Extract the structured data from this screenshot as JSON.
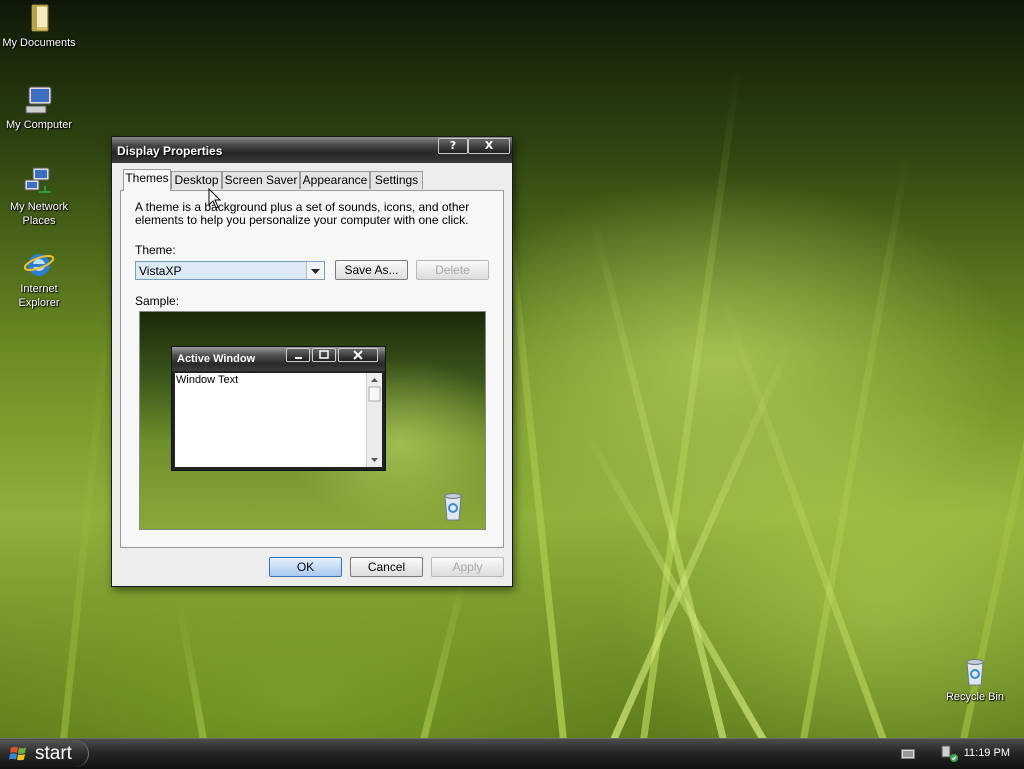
{
  "desktop": {
    "icons": [
      {
        "label": "My Documents",
        "icon": "folder-documents-icon"
      },
      {
        "label": "My Computer",
        "icon": "computer-icon"
      },
      {
        "label": "My Network Places",
        "icon": "network-places-icon"
      },
      {
        "label": "Internet Explorer",
        "icon": "internet-explorer-icon"
      },
      {
        "label": "Recycle Bin",
        "icon": "recycle-bin-icon"
      }
    ]
  },
  "dialog": {
    "title": "Display Properties",
    "help_button": "?",
    "close_button": "X",
    "tabs": [
      {
        "label": "Themes",
        "active": true
      },
      {
        "label": "Desktop",
        "active": false
      },
      {
        "label": "Screen Saver",
        "active": false
      },
      {
        "label": "Appearance",
        "active": false
      },
      {
        "label": "Settings",
        "active": false
      }
    ],
    "description": "A theme is a background plus a set of sounds, icons, and other elements to help you personalize your computer with one click.",
    "theme_label": "Theme:",
    "theme_value": "VistaXP",
    "save_as_button": "Save As...",
    "delete_button": "Delete",
    "sample_label": "Sample:",
    "sample": {
      "window_title": "Active Window",
      "window_text": "Window Text"
    },
    "ok_button": "OK",
    "cancel_button": "Cancel",
    "apply_button": "Apply"
  },
  "taskbar": {
    "start_label": "start",
    "clock": "11:19 PM"
  },
  "colors": {
    "accent": "#3a73b8",
    "titlebar": "#2a2a2a",
    "dialog_bg": "#ededed"
  }
}
